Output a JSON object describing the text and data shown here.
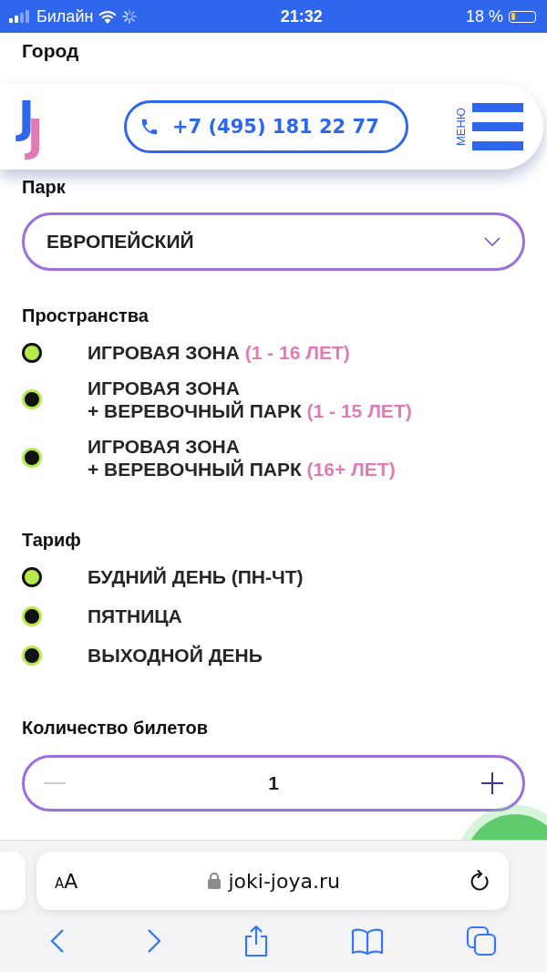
{
  "status_bar": {
    "carrier": "Билайн",
    "time": "21:32",
    "battery": "18 %"
  },
  "header": {
    "logo": "JJ",
    "phone": "+7 (495) 181 22 77",
    "menu_label": "МЕНЮ"
  },
  "city_label": "Город",
  "park": {
    "label": "Парк",
    "value": "ЕВРОПЕЙСКИЙ"
  },
  "spaces": {
    "label": "Пространства",
    "options": [
      {
        "lines": [
          "ИГРОВАЯ ЗОНА"
        ],
        "note": "(1 - 16 ЛЕТ)",
        "selected": true
      },
      {
        "lines": [
          "ИГРОВАЯ ЗОНА",
          "+ ВЕРЕВОЧНЫЙ ПАРК"
        ],
        "note": "(1 - 15 ЛЕТ)",
        "selected": false
      },
      {
        "lines": [
          "ИГРОВАЯ ЗОНА",
          "+ ВЕРЕВОЧНЫЙ ПАРК"
        ],
        "note": "(16+ ЛЕТ)",
        "selected": false
      }
    ]
  },
  "tariff": {
    "label": "Тариф",
    "options": [
      {
        "lines": [
          "БУДНИЙ ДЕНЬ (ПН-ЧТ)"
        ],
        "selected": true
      },
      {
        "lines": [
          "ПЯТНИЦА"
        ],
        "selected": false
      },
      {
        "lines": [
          "ВЫХОДНОЙ ДЕНЬ"
        ],
        "selected": false
      }
    ]
  },
  "tickets": {
    "label": "Количество билетов",
    "value": "1",
    "minus_disabled": true
  },
  "browser": {
    "text_size_small": "A",
    "text_size_large": "A",
    "url": "joki-joya.ru"
  }
}
